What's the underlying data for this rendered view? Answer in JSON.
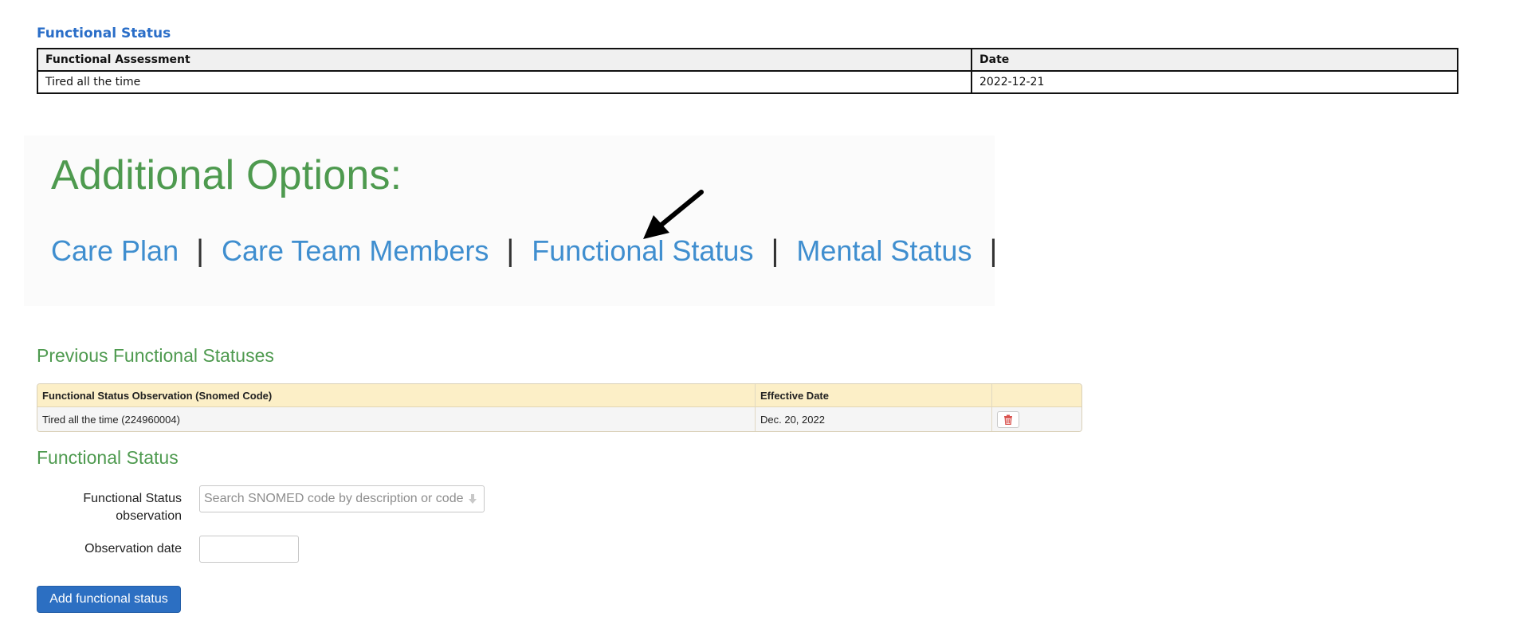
{
  "summary": {
    "title": "Functional Status",
    "headers": [
      "Functional Assessment",
      "Date"
    ],
    "rows": [
      [
        "Tired all the time",
        "2022-12-21"
      ]
    ]
  },
  "options": {
    "title": "Additional Options:",
    "links": [
      "Care Plan",
      "Care Team Members",
      "Functional Status",
      "Mental Status"
    ],
    "separator": "|"
  },
  "previous": {
    "title": "Previous Functional Statuses",
    "headers": [
      "Functional Status Observation (Snomed Code)",
      "Effective Date",
      ""
    ],
    "rows": [
      [
        "Tired all the time (224960004)",
        "Dec. 20, 2022"
      ]
    ]
  },
  "form": {
    "title": "Functional Status",
    "observation_label_line1": "Functional Status",
    "observation_label_line2": "observation",
    "search_placeholder": "Search SNOMED code by description or code",
    "date_label": "Observation date",
    "date_value": "",
    "submit_label": "Add functional status"
  },
  "colors": {
    "heading_green": "#4e9a4f",
    "link_blue": "#3f8ecf",
    "primary_button": "#2c6fc2",
    "table_header_yellow": "#fcefc7",
    "trash_red": "#d9534f"
  },
  "icons": {
    "annotation_arrow": "arrow-pointer-icon",
    "delete": "trash-icon",
    "dropdown": "arrow-down-icon"
  }
}
